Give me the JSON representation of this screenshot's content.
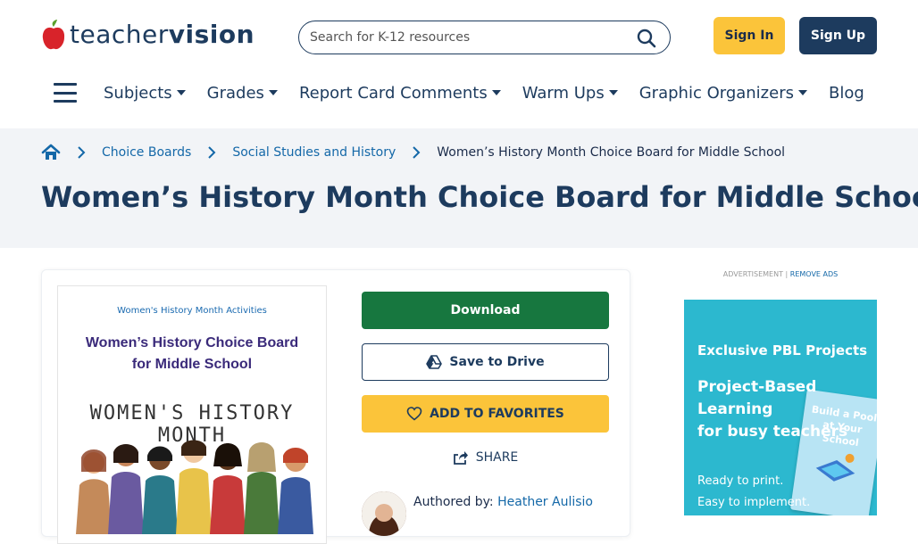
{
  "header": {
    "logo_part1": "teacher",
    "logo_part2": "vision",
    "search_placeholder": "Search for K-12 resources",
    "sign_in": "Sign In",
    "sign_up": "Sign Up"
  },
  "nav": {
    "items": [
      {
        "label": "Subjects"
      },
      {
        "label": "Grades"
      },
      {
        "label": "Report Card Comments"
      },
      {
        "label": "Warm Ups"
      },
      {
        "label": "Graphic Organizers"
      },
      {
        "label": "Blog"
      }
    ]
  },
  "breadcrumb": {
    "items": [
      "Choice Boards",
      "Social Studies and History"
    ],
    "current": "Women’s History Month Choice Board for Middle School"
  },
  "page": {
    "title": "Women’s History Month Choice Board for Middle School"
  },
  "resource": {
    "thumb_sub": "Women's History Month Activities",
    "thumb_title_line1": "Women’s History Choice Board",
    "thumb_title_line2": "for Middle School",
    "thumb_hand": "WOMEN'S HISTORY MONTH",
    "download": "Download",
    "save_drive": "Save to Drive",
    "favorites": "ADD TO FAVORITES",
    "share": "SHARE",
    "authored_by": "Authored by:",
    "author_name": "Heather Aulisio"
  },
  "ad": {
    "label": "ADVERTISEMENT |",
    "remove": "REMOVE ADS",
    "heading": "Exclusive PBL Projects",
    "title_line1": "Project-Based",
    "title_line2": "Learning",
    "title_line3": "for busy teachers",
    "book_title": "Build a Pool at Your School",
    "line1": "Ready to print.",
    "line2": "Easy to implement."
  },
  "colors": {
    "brand_navy": "#1d3b5e",
    "accent_yellow": "#fbc43a",
    "download_green": "#17773f",
    "link_blue": "#1468a8",
    "ad_teal": "#2cb8cf"
  },
  "icons": [
    "apple-icon",
    "search-icon",
    "menu-icon",
    "home-icon",
    "chevron-right-icon",
    "google-drive-icon",
    "heart-icon",
    "share-icon"
  ]
}
